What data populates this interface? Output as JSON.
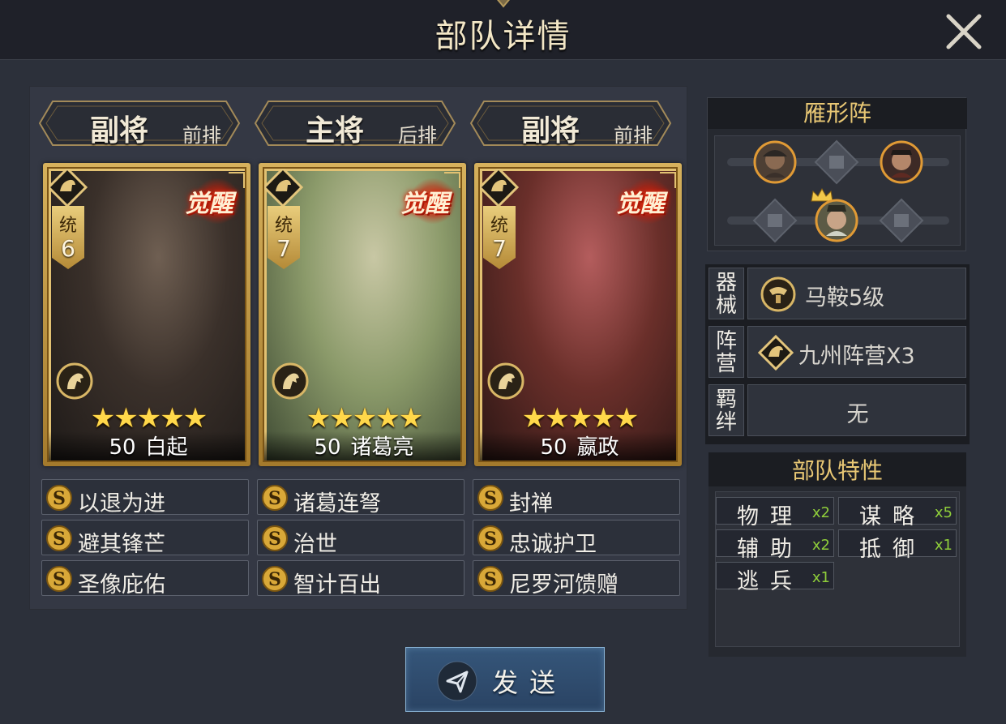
{
  "header": {
    "title": "部队详情"
  },
  "positions": [
    {
      "role": "副将",
      "row": "前排"
    },
    {
      "role": "主将",
      "row": "后排"
    },
    {
      "role": "副将",
      "row": "前排"
    }
  ],
  "cards": [
    {
      "command_label": "统",
      "command_value": "6",
      "awaken_label": "觉醒",
      "stars": "★★★★★",
      "level": "50",
      "name": "白起",
      "palette": [
        "#6f5f52",
        "#3a302a",
        "#1e1a18"
      ]
    },
    {
      "command_label": "统",
      "command_value": "7",
      "awaken_label": "觉醒",
      "stars": "★★★★★",
      "level": "50",
      "name": "诸葛亮",
      "palette": [
        "#c8c7a4",
        "#8b9a6a",
        "#3e4a33"
      ]
    },
    {
      "command_label": "统",
      "command_value": "7",
      "awaken_label": "觉醒",
      "stars": "★★★★★",
      "level": "50",
      "name": "嬴政",
      "palette": [
        "#b45d5d",
        "#6a2f2a",
        "#2a1614"
      ]
    }
  ],
  "skills": [
    [
      "以退为进",
      "避其锋芒",
      "圣像庇佑"
    ],
    [
      "诸葛连弩",
      "治世",
      "智计百出"
    ],
    [
      "封禅",
      "忠诚护卫",
      "尼罗河馈赠"
    ]
  ],
  "formation": {
    "title": "雁形阵"
  },
  "equipment": [
    {
      "label": "器械",
      "value": "马鞍5级"
    },
    {
      "label": "阵营",
      "value": "九州阵营X3"
    },
    {
      "label": "羁绊",
      "value": "无"
    }
  ],
  "traits": {
    "title": "部队特性",
    "items": [
      {
        "name": "物理",
        "mult": "x2"
      },
      {
        "name": "谋略",
        "mult": "x5"
      },
      {
        "name": "辅助",
        "mult": "x2"
      },
      {
        "name": "抵御",
        "mult": "x1"
      },
      {
        "name": "逃兵",
        "mult": "x1"
      }
    ]
  },
  "send_button": {
    "label": "发送"
  },
  "colors": {
    "gold": "#e8c774",
    "accent_green": "#8fce3a",
    "button_blue": "#35567a"
  }
}
